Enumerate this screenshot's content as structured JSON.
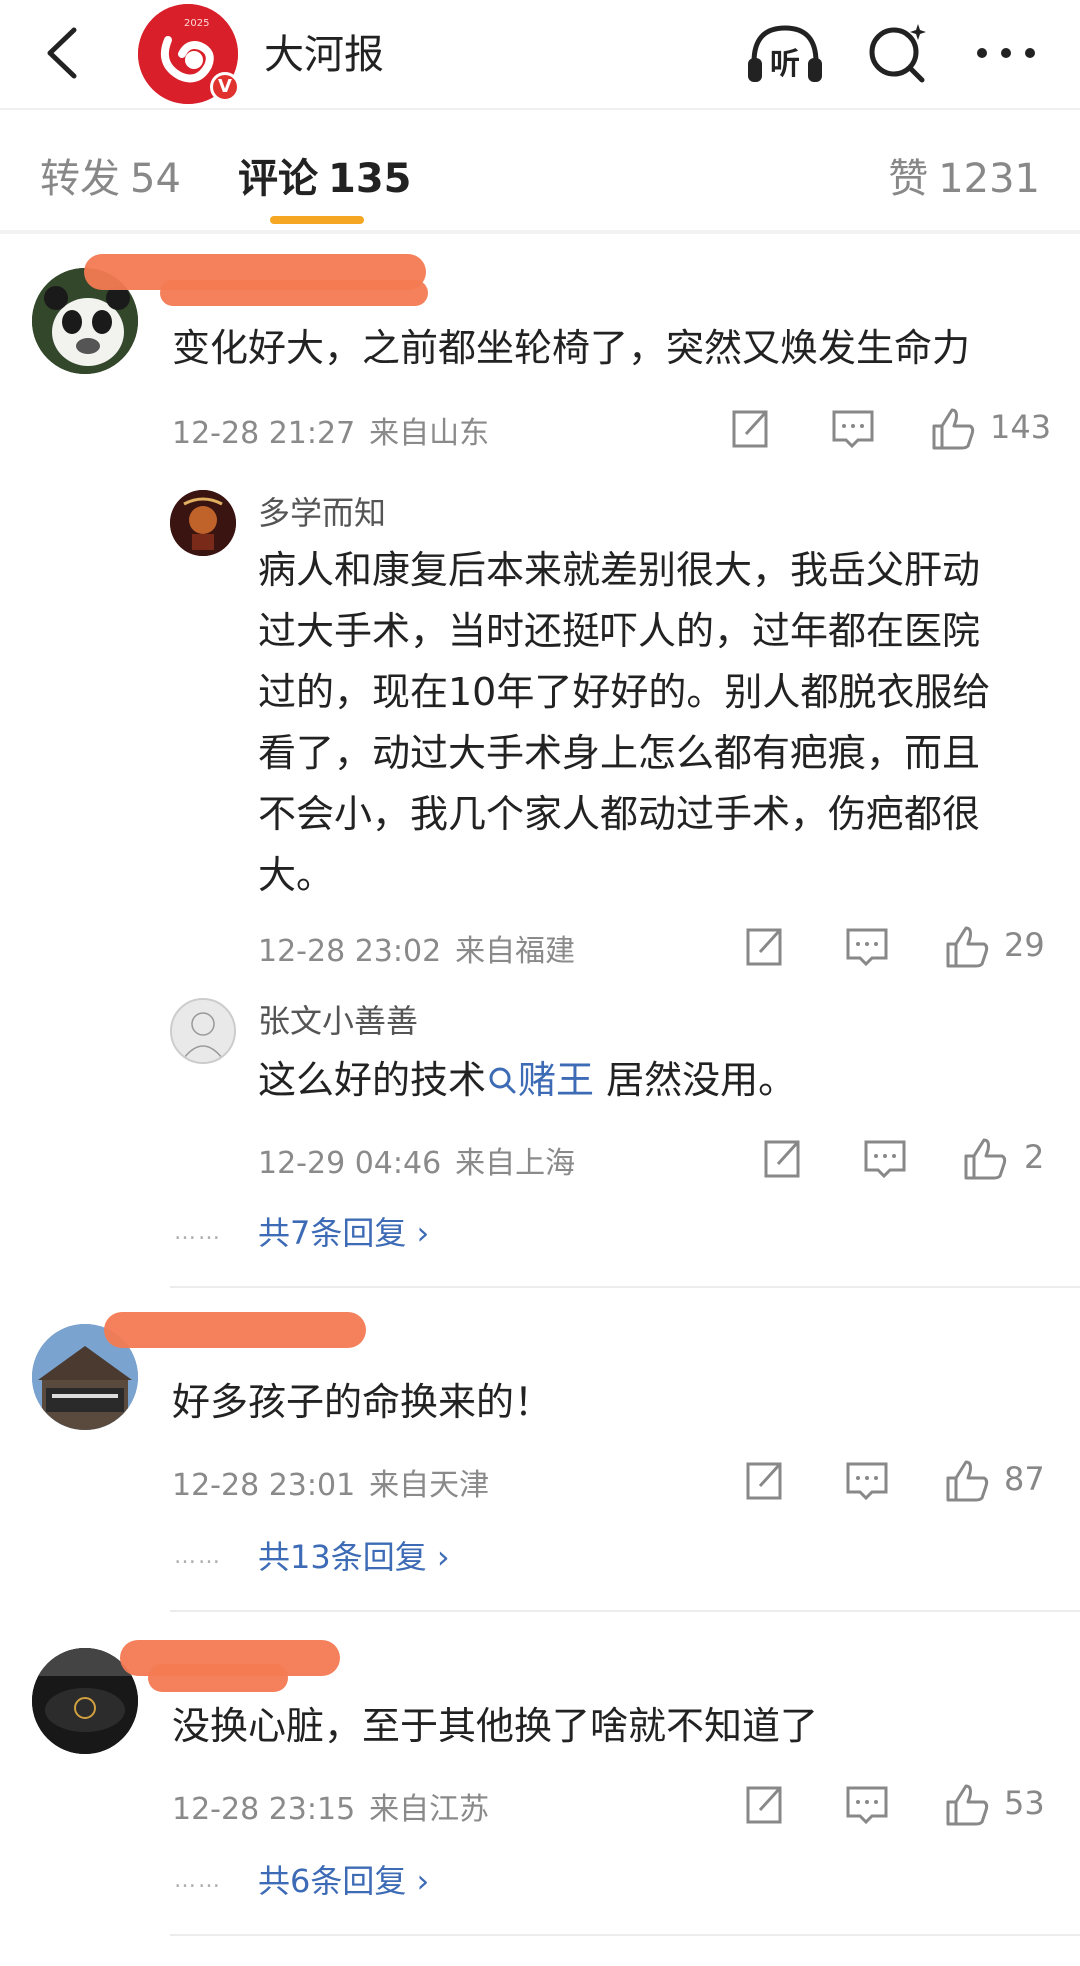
{
  "header": {
    "app_name": "大河报",
    "logo_year": "2025",
    "logo_badge": "V",
    "listen_label": "听",
    "icons": [
      "back-icon",
      "listen-icon",
      "search-icon",
      "more-icon"
    ]
  },
  "tabs": {
    "repost_label": "转发",
    "repost_count": "54",
    "comment_label": "评论",
    "comment_count": "135",
    "like_label": "赞",
    "like_count": "1231"
  },
  "comments": [
    {
      "text": "变化好大，之前都坐轮椅了，突然又焕发生命力",
      "time": "12-28 21:27",
      "location": "来自山东",
      "likes": "143",
      "replies": [
        {
          "user": "多学而知",
          "lines": [
            "病人和康复后本来就差别很大，我岳父肝动",
            "过大手术，当时还挺吓人的，过年都在医院",
            "过的，现在10年了好好的。别人都脱衣服给",
            "看了，动过大手术身上怎么都有疤痕，而且",
            "不会小，我几个家人都动过手术，伤疤都很",
            "大。"
          ],
          "time": "12-28 23:02",
          "location": "来自福建",
          "likes": "29"
        },
        {
          "user": "张文小善善",
          "text_before": "这么好的技术",
          "hashtag": "赌王",
          "text_after": " 居然没用。",
          "time": "12-29 04:46",
          "location": "来自上海",
          "likes": "2"
        }
      ],
      "more_replies": "共7条回复 ›"
    },
    {
      "text": "好多孩子的命换来的！",
      "time": "12-28 23:01",
      "location": "来自天津",
      "likes": "87",
      "more_replies": "共13条回复 ›"
    },
    {
      "text": "没换心脏，至于其他换了啥就不知道了",
      "time": "12-28 23:15",
      "location": "来自江苏",
      "likes": "53",
      "more_replies": "共6条回复 ›"
    }
  ],
  "colors": {
    "accent": "#f5a623",
    "link": "#3d6bb5",
    "redaction": "#f37a52",
    "logo": "#d9202a"
  },
  "dots": "……"
}
